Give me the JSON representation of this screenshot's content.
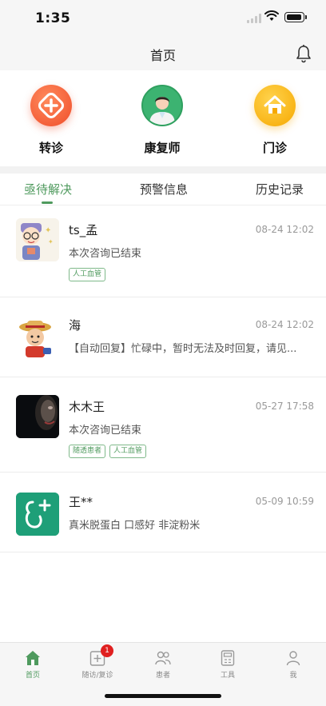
{
  "status_bar": {
    "time": "1:35"
  },
  "nav": {
    "title": "首页",
    "bell_icon": "bell-icon"
  },
  "quick_actions": [
    {
      "label": "转诊",
      "icon": "plus-cross-icon",
      "color": "#ef4d2a"
    },
    {
      "label": "康复师",
      "icon": "doctor-avatar",
      "color": "#3cb371"
    },
    {
      "label": "门诊",
      "icon": "house-icon",
      "color": "#f6a800"
    }
  ],
  "tabs": [
    {
      "label": "亟待解决",
      "active": true
    },
    {
      "label": "预警信息",
      "active": false
    },
    {
      "label": "历史记录",
      "active": false
    }
  ],
  "accent_color": "#4f9a5e",
  "conversations": [
    {
      "name": "ts_孟",
      "time": "08-24 12:02",
      "message": "本次咨询已结束",
      "tags": [
        "人工血管"
      ],
      "avatar": "cartoon-kid-glasses"
    },
    {
      "name": "海",
      "time": "08-24 12:02",
      "message": "【自动回复】忙碌中，暂时无法及时回复，请见...",
      "tags": [],
      "avatar": "cartoon-kid-hat"
    },
    {
      "name": "木木王",
      "time": "05-27 17:58",
      "message": "本次咨询已结束",
      "tags": [
        "随透患者",
        "人工血管"
      ],
      "avatar": "dark-face-photo"
    },
    {
      "name": "王**",
      "time": "05-09 10:59",
      "message": "真米脱蛋白 口感好 非淀粉米",
      "tags": [],
      "avatar": "green-kidney-logo"
    }
  ],
  "bottom_tabs": [
    {
      "label": "首页",
      "icon": "home-icon",
      "active": true
    },
    {
      "label": "随访/复诊",
      "icon": "followup-icon",
      "active": false,
      "badge": "1"
    },
    {
      "label": "患者",
      "icon": "patients-icon",
      "active": false
    },
    {
      "label": "工具",
      "icon": "calculator-icon",
      "active": false
    },
    {
      "label": "我",
      "icon": "person-icon",
      "active": false
    }
  ]
}
